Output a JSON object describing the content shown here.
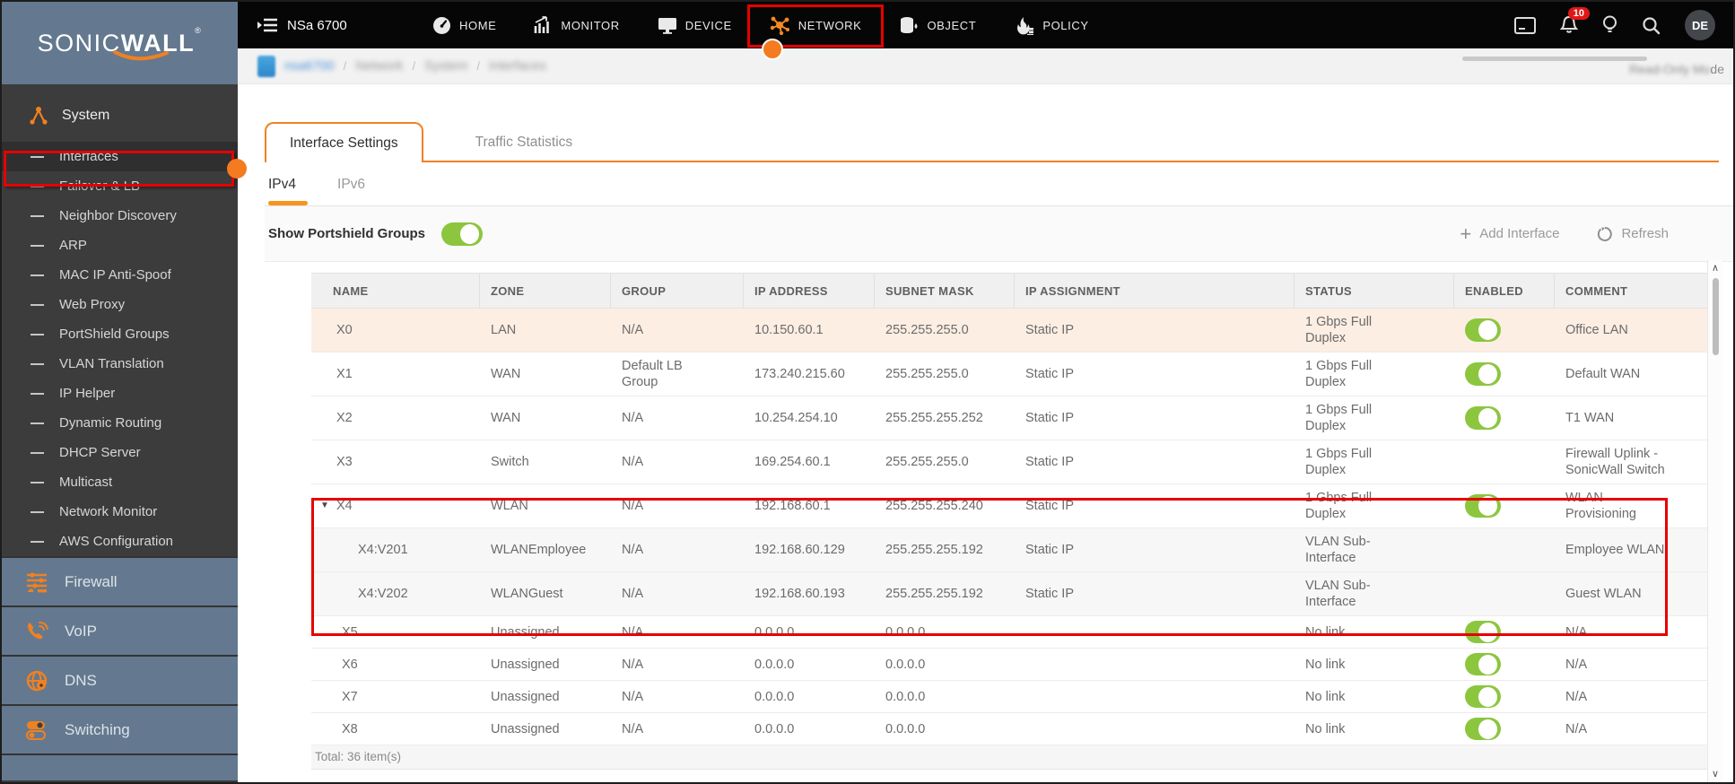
{
  "colors": {
    "accent_orange": "#f08121",
    "toggle_green": "#8cc63f",
    "annotation_red": "#e60000",
    "selected_row_peach": "#fdeee3",
    "sidebar_blue_gray": "#64798f",
    "sidebar_dark": "#3c3c3c",
    "badge_red": "#e01717"
  },
  "brand": {
    "wordmark_light": "SONIC",
    "wordmark_bold": "WALL",
    "registered": "®"
  },
  "topbar": {
    "device_name": "NSa 6700",
    "nav": [
      {
        "label": "HOME"
      },
      {
        "label": "MONITOR"
      },
      {
        "label": "DEVICE"
      },
      {
        "label": "NETWORK",
        "active": true
      },
      {
        "label": "OBJECT"
      },
      {
        "label": "POLICY"
      }
    ],
    "notification_badge": "10",
    "avatar_initials": "DE"
  },
  "breadcrumb": {
    "segments": [
      "nsa6700",
      "Network",
      "System",
      "Interfaces"
    ],
    "separator": "/",
    "mode_label_blurred": "Read-Only Mo",
    "mode_label_clear": "de"
  },
  "sidebar": {
    "section_header": "System",
    "items": [
      {
        "label": "Interfaces",
        "cls": "active"
      },
      {
        "label": "Failover & LB"
      },
      {
        "label": "Neighbor Discovery"
      },
      {
        "label": "ARP"
      },
      {
        "label": "MAC IP Anti-Spoof"
      },
      {
        "label": "Web Proxy"
      },
      {
        "label": "PortShield Groups"
      },
      {
        "label": "VLAN Translation"
      },
      {
        "label": "IP Helper"
      },
      {
        "label": "Dynamic Routing"
      },
      {
        "label": "DHCP Server"
      },
      {
        "label": "Multicast"
      },
      {
        "label": "Network Monitor"
      },
      {
        "label": "AWS Configuration"
      }
    ],
    "groups": [
      {
        "label": "Firewall"
      },
      {
        "label": "VoIP"
      },
      {
        "label": "DNS"
      },
      {
        "label": "Switching"
      }
    ]
  },
  "main": {
    "tabs": [
      {
        "label": "Interface Settings",
        "active": true
      },
      {
        "label": "Traffic Statistics"
      }
    ],
    "subtabs": [
      {
        "label": "IPv4",
        "active": true
      },
      {
        "label": "IPv6"
      }
    ],
    "portshield_toggle_label": "Show Portshield Groups",
    "actions": {
      "add_interface": "Add Interface",
      "refresh": "Refresh"
    },
    "table": {
      "columns": [
        "NAME",
        "ZONE",
        "GROUP",
        "IP ADDRESS",
        "SUBNET MASK",
        "IP ASSIGNMENT",
        "STATUS",
        "ENABLED",
        "COMMENT"
      ],
      "rows": [
        {
          "cls": "selected",
          "expand": "",
          "name": "X0",
          "zone": "LAN",
          "group": "N/A",
          "ip": "10.150.60.1",
          "mask": "255.255.255.0",
          "assign": "Static IP",
          "status": "1 Gbps Full Duplex",
          "enabled": "on",
          "comment": "Office LAN"
        },
        {
          "cls": "",
          "expand": "",
          "name": "X1",
          "zone": "WAN",
          "group": "Default LB Group",
          "ip": "173.240.215.60",
          "mask": "255.255.255.0",
          "assign": "Static IP",
          "status": "1 Gbps Full Duplex",
          "enabled": "on",
          "comment": "Default WAN"
        },
        {
          "cls": "",
          "expand": "",
          "name": "X2",
          "zone": "WAN",
          "group": "N/A",
          "ip": "10.254.254.10",
          "mask": "255.255.255.252",
          "assign": "Static IP",
          "status": "1 Gbps Full Duplex",
          "enabled": "on",
          "comment": "T1 WAN"
        },
        {
          "cls": "",
          "expand": "",
          "name": "X3",
          "zone": "Switch",
          "group": "N/A",
          "ip": "169.254.60.1",
          "mask": "255.255.255.0",
          "assign": "Static IP",
          "status": "1 Gbps Full Duplex",
          "enabled": "",
          "comment": "Firewall Uplink - SonicWall Switch"
        },
        {
          "cls": "",
          "expand": "▼",
          "name": "X4",
          "zone": "WLAN",
          "group": "N/A",
          "ip": "192.168.60.1",
          "mask": "255.255.255.240",
          "assign": "Static IP",
          "status": "1 Gbps Full Duplex",
          "enabled": "on",
          "comment": "WLAN Provisioning"
        },
        {
          "cls": "sub",
          "expand": "",
          "name": "X4:V201",
          "zone": "WLANEmployee",
          "group": "N/A",
          "ip": "192.168.60.129",
          "mask": "255.255.255.192",
          "assign": "Static IP",
          "status": "VLAN Sub-Interface",
          "enabled": "",
          "comment": "Employee WLAN"
        },
        {
          "cls": "sub",
          "expand": "",
          "name": "X4:V202",
          "zone": "WLANGuest",
          "group": "N/A",
          "ip": "192.168.60.193",
          "mask": "255.255.255.192",
          "assign": "Static IP",
          "status": "VLAN Sub-Interface",
          "enabled": "",
          "comment": "Guest WLAN"
        },
        {
          "cls": "compact",
          "expand": "",
          "name": "X5",
          "zone": "Unassigned",
          "group": "N/A",
          "ip": "0.0.0.0",
          "mask": "0.0.0.0",
          "assign": "",
          "status": "No link",
          "enabled": "on",
          "comment": "N/A"
        },
        {
          "cls": "compact",
          "expand": "",
          "name": "X6",
          "zone": "Unassigned",
          "group": "N/A",
          "ip": "0.0.0.0",
          "mask": "0.0.0.0",
          "assign": "",
          "status": "No link",
          "enabled": "on",
          "comment": "N/A"
        },
        {
          "cls": "compact",
          "expand": "",
          "name": "X7",
          "zone": "Unassigned",
          "group": "N/A",
          "ip": "0.0.0.0",
          "mask": "0.0.0.0",
          "assign": "",
          "status": "No link",
          "enabled": "on",
          "comment": "N/A"
        },
        {
          "cls": "compact",
          "expand": "",
          "name": "X8",
          "zone": "Unassigned",
          "group": "N/A",
          "ip": "0.0.0.0",
          "mask": "0.0.0.0",
          "assign": "",
          "status": "No link",
          "enabled": "on",
          "comment": "N/A"
        }
      ],
      "total": "Total: 36 item(s)"
    }
  }
}
